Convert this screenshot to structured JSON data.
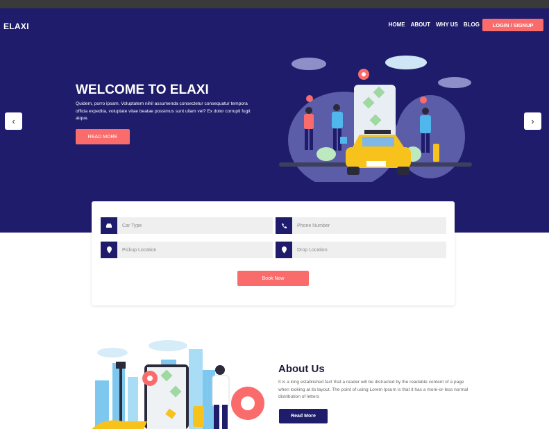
{
  "brand": "ELAXI",
  "nav": {
    "items": [
      "HOME",
      "ABOUT",
      "WHY US",
      "BLOG"
    ],
    "login": "LOGIN / SIGNUP"
  },
  "hero": {
    "title": "WELCOME TO ELAXI",
    "text": "Quidem, porro ipsam. Voluptatem nihil assumenda consectetur consequatur tempora officia expedita, voluptate vitae beatae possimus sunt ullam vel? Ex dolor corrupti fugit atque.",
    "cta": "READ MORE",
    "prev_icon": "chevron-left-icon",
    "next_icon": "chevron-right-icon"
  },
  "booking": {
    "car_type": "Car Type",
    "phone": "Phone Number",
    "pickup": "Pickup Location",
    "drop": "Drop Location",
    "submit": "Book Now"
  },
  "about": {
    "title": "About Us",
    "text": "It is a long established fact that a reader will be distracted by the readable content of a page when looking at its layout. The point of using Lorem Ipsum is that it has a more-or-less normal distribution of letters",
    "cta": "Read More"
  },
  "colors": {
    "primary": "#1f1c6b",
    "accent": "#fa6c6c",
    "taxi": "#f7c21b"
  }
}
